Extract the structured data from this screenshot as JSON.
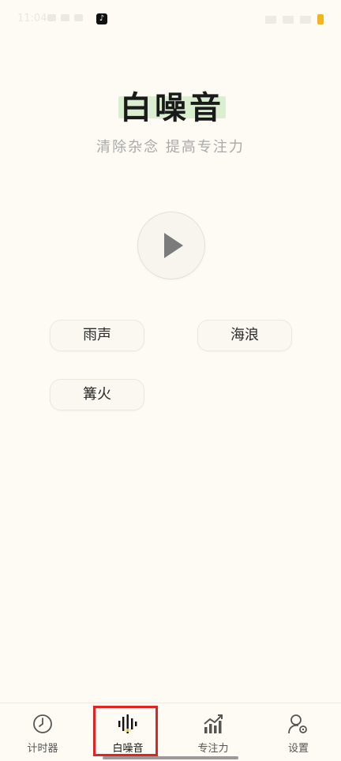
{
  "app": {
    "title": "白噪音",
    "subtitle": "清除杂念 提高专注力"
  },
  "status_bar": {
    "time": "11:04",
    "notification_icon": "tiktok-icon",
    "battery_color": "#f2b51f"
  },
  "player": {
    "play_icon": "play-icon"
  },
  "sounds": [
    {
      "label": "雨声"
    },
    {
      "label": "海浪"
    },
    {
      "label": "篝火"
    }
  ],
  "tabs": [
    {
      "label": "计时器",
      "icon": "clock-icon"
    },
    {
      "label": "白噪音",
      "icon": "soundwave-icon",
      "active": true
    },
    {
      "label": "专注力",
      "icon": "chart-up-icon"
    },
    {
      "label": "设置",
      "icon": "user-gear-icon"
    }
  ],
  "colors": {
    "background": "#fdfbf3",
    "title_highlight": "#d9efcf",
    "selection_box": "#e02323"
  }
}
